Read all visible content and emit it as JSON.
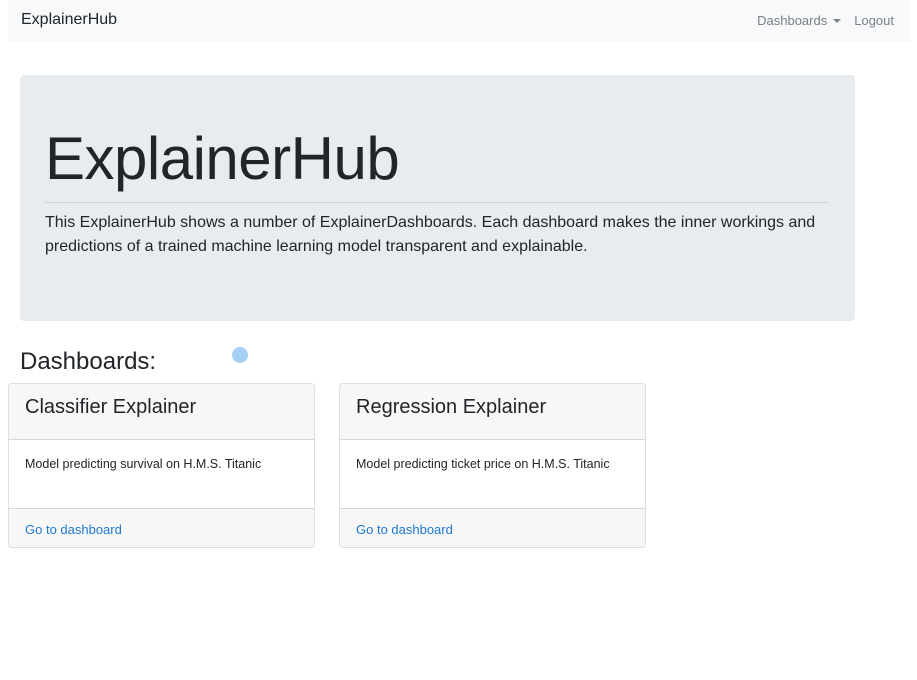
{
  "navbar": {
    "brand": "ExplainerHub",
    "dashboards_label": "Dashboards",
    "logout_label": "Logout"
  },
  "jumbotron": {
    "title": "ExplainerHub",
    "lead": "This ExplainerHub shows a number of ExplainerDashboards. Each dashboard makes the inner workings and predictions of a trained machine learning model transparent and explainable."
  },
  "section": {
    "title": "Dashboards:"
  },
  "cards": [
    {
      "title": "Classifier Explainer",
      "description": "Model predicting survival on H.M.S. Titanic",
      "link_label": "Go to dashboard"
    },
    {
      "title": "Regression Explainer",
      "description": "Model predicting ticket price on H.M.S. Titanic",
      "link_label": "Go to dashboard"
    }
  ],
  "icons": {
    "dropdown": "caret-down-icon",
    "cursor": "cursor-dot-icon"
  },
  "colors": {
    "navbar_bg": "#f8f9fa",
    "jumbotron_bg": "#e9ecef",
    "link": "#1f78d1",
    "cursor": "#a6d0f5"
  }
}
